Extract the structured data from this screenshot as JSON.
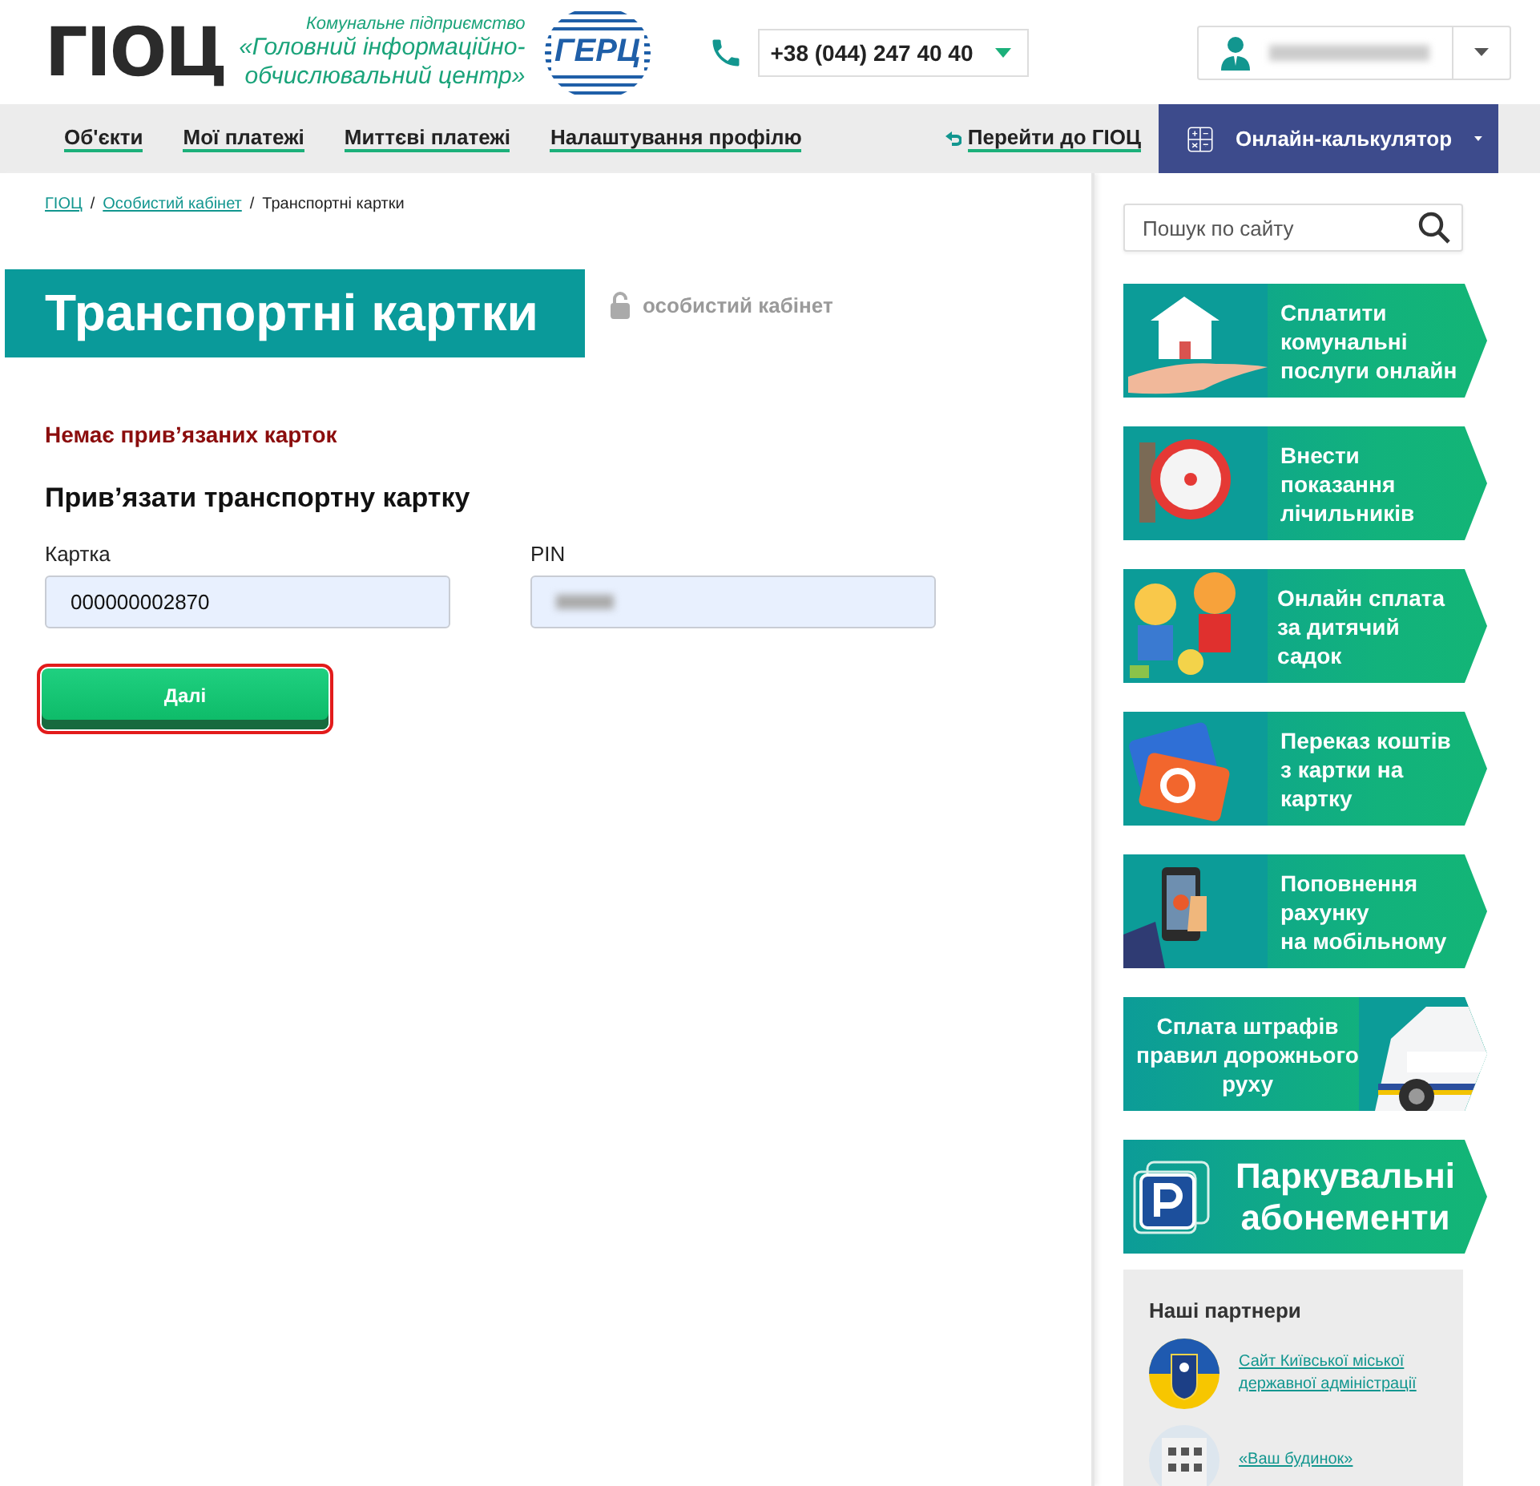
{
  "header": {
    "logo": "ГІОЦ",
    "org_lines": "Комунальне підприємство",
    "org_name": "«Головний інформаційно-\nобчислювальний центр»",
    "partner_logo": "ГЕРЦ",
    "phone": "+38 (044) 247 40 40",
    "user": {
      "name_blurred": true
    }
  },
  "nav": {
    "items": [
      {
        "label": "Об'єкти"
      },
      {
        "label": "Мої платежі"
      },
      {
        "label": "Миттєві платежі"
      },
      {
        "label": "Налаштування профілю"
      }
    ],
    "back_link": "Перейти до ГІОЦ",
    "calculator": "Онлайн-калькулятор"
  },
  "breadcrumbs": [
    {
      "label": "ГІОЦ",
      "kind": "link"
    },
    {
      "label": "/",
      "kind": "separator"
    },
    {
      "label": "Особистий кабінет",
      "kind": "link"
    },
    {
      "label": "/",
      "kind": "separator"
    },
    {
      "label": "Транспортні картки",
      "kind": "current"
    }
  ],
  "title": "Транспортні картки",
  "title_note": "особистий кабінет",
  "notice": "Немає прив’язаних карток",
  "form": {
    "title": "Прив’язати транспортну картку",
    "fields": [
      {
        "label": "Картка",
        "value": "000000002870",
        "blurred": false
      },
      {
        "label": "PIN",
        "blurred": true
      }
    ],
    "button": {
      "label": "Далі",
      "focused": true
    }
  },
  "sidebar": {
    "search": {
      "placeholder": "Пошук по сайту"
    },
    "banners": [
      {
        "kind": "picture-left",
        "text": "Сплатити\nкомунальні\nпослуги онлайн"
      },
      {
        "kind": "picture-left",
        "text": "Внести\nпоказання\nлічильників"
      },
      {
        "kind": "picture-left",
        "text": "Онлайн сплата\nза дитячий садок"
      },
      {
        "kind": "picture-left",
        "text": "Переказ коштів\nз картки на картку"
      },
      {
        "kind": "picture-left",
        "text": "Поповнення рахунку\nна мобільному"
      },
      {
        "kind": "picture-right",
        "text": "Сплата штрафів\nправил дорожнього\nруху"
      },
      {
        "kind": "icon",
        "text": "Паркувальні\nабонементи"
      }
    ],
    "partners": {
      "title": "Наші партнери",
      "items": [
        {
          "label": "Сайт Київської міської\nдержавної адміністрації"
        },
        {
          "label": "«Ваш будинок»"
        }
      ]
    }
  }
}
